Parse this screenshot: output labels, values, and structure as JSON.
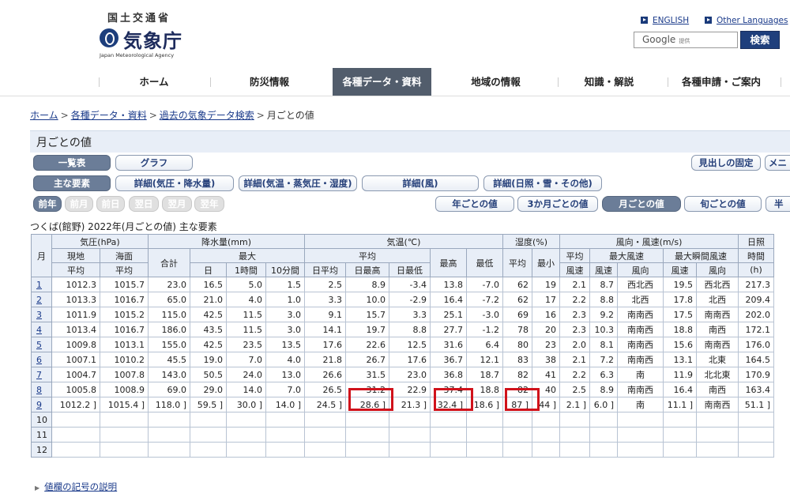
{
  "header": {
    "gov_label": "国土交通省",
    "agency_name": "気象庁",
    "agency_name_en": "Japan Meteorological Agency",
    "lang_english": "ENGLISH",
    "lang_other": "Other Languages",
    "search_placeholder_brand": "Google",
    "search_placeholder_sub": "提供",
    "search_button": "検索"
  },
  "nav": {
    "items": [
      "ホーム",
      "防災情報",
      "各種データ・資料",
      "地域の情報",
      "知識・解説",
      "各種申請・ご案内"
    ],
    "active_index": 2
  },
  "breadcrumb": [
    "ホーム",
    "各種データ・資料",
    "過去の気象データ検索",
    "月ごとの値"
  ],
  "page_title": "月ごとの値",
  "view_buttons": {
    "list": "一覧表",
    "graph": "グラフ"
  },
  "fixed_header_button": "見出しの固定",
  "menu_button_partial": "メニ",
  "element_tabs": [
    "主な要素",
    "詳細(気圧・降水量)",
    "詳細(気温・蒸気圧・湿度)",
    "詳細(風)",
    "詳細(日照・雪・その他)"
  ],
  "nav_buttons": [
    "前年",
    "前月",
    "前日",
    "翌日",
    "翌月",
    "翌年"
  ],
  "period_buttons": [
    "年ごとの値",
    "3か月ごとの値",
    "月ごとの値",
    "旬ごとの値",
    "半"
  ],
  "period_selected_index": 2,
  "subtitle": "つくば(館野)  2022年(月ごとの値)  主な要素",
  "table": {
    "h": {
      "month": "月",
      "pressure": "気圧(hPa)",
      "station": "現地",
      "sea": "海面",
      "avg": "平均",
      "precip": "降水量(mm)",
      "total": "合計",
      "max": "最大",
      "day": "日",
      "hour1": "1時間",
      "min10": "10分間",
      "temp": "気温(℃)",
      "tavg": "平均",
      "daily_avg": "日平均",
      "daily_max": "日最高",
      "daily_min": "日最低",
      "highest": "最高",
      "lowest": "最低",
      "humidity": "湿度(%)",
      "h_avg": "平均",
      "h_min": "最小",
      "wind": "風向・風速(m/s)",
      "wind_avg1": "平均",
      "wind_avg2": "風速",
      "max_wind": "最大風速",
      "max_gust": "最大瞬間風速",
      "speed": "風速",
      "dir": "風向",
      "speed2": "風速",
      "dir2": "風向",
      "sun1": "日照",
      "sun2": "時間",
      "sun3": "(h)"
    },
    "rows": [
      [
        "1",
        "1012.3",
        "1015.7",
        "23.0",
        "16.5",
        "5.0",
        "1.5",
        "2.5",
        "8.9",
        "-3.4",
        "13.8",
        "-7.0",
        "62",
        "19",
        "2.1",
        "8.7",
        "西北西",
        "19.5",
        "西北西",
        "217.3"
      ],
      [
        "2",
        "1013.3",
        "1016.7",
        "65.0",
        "21.0",
        "4.0",
        "1.0",
        "3.3",
        "10.0",
        "-2.9",
        "16.4",
        "-7.2",
        "62",
        "17",
        "2.2",
        "8.8",
        "北西",
        "17.8",
        "北西",
        "209.4"
      ],
      [
        "3",
        "1011.9",
        "1015.2",
        "115.0",
        "42.5",
        "11.5",
        "3.0",
        "9.1",
        "15.7",
        "3.3",
        "25.1",
        "-3.0",
        "69",
        "16",
        "2.3",
        "9.2",
        "南南西",
        "17.5",
        "南南西",
        "202.0"
      ],
      [
        "4",
        "1013.4",
        "1016.7",
        "186.0",
        "43.5",
        "11.5",
        "3.0",
        "14.1",
        "19.7",
        "8.8",
        "27.7",
        "-1.2",
        "78",
        "20",
        "2.3",
        "10.3",
        "南南西",
        "18.8",
        "南西",
        "172.1"
      ],
      [
        "5",
        "1009.8",
        "1013.1",
        "155.0",
        "42.5",
        "23.5",
        "13.5",
        "17.6",
        "22.6",
        "12.5",
        "31.6",
        "6.4",
        "80",
        "23",
        "2.0",
        "8.1",
        "南南西",
        "15.6",
        "南南西",
        "176.0"
      ],
      [
        "6",
        "1007.1",
        "1010.2",
        "45.5",
        "19.0",
        "7.0",
        "4.0",
        "21.8",
        "26.7",
        "17.6",
        "36.7",
        "12.1",
        "83",
        "38",
        "2.1",
        "7.2",
        "南南西",
        "13.1",
        "北東",
        "164.5"
      ],
      [
        "7",
        "1004.7",
        "1007.8",
        "143.0",
        "50.5",
        "24.0",
        "13.0",
        "26.6",
        "31.5",
        "23.0",
        "36.8",
        "18.7",
        "82",
        "41",
        "2.2",
        "6.3",
        "南",
        "11.9",
        "北北東",
        "170.9"
      ],
      [
        "8",
        "1005.8",
        "1008.9",
        "69.0",
        "29.0",
        "14.0",
        "7.0",
        "26.5",
        "31.2",
        "22.9",
        "37.4",
        "18.8",
        "82",
        "40",
        "2.5",
        "8.9",
        "南南西",
        "16.4",
        "南西",
        "163.4"
      ],
      [
        "9",
        "1012.2 ]",
        "1015.4 ]",
        "118.0 ]",
        "59.5 ]",
        "30.0 ]",
        "14.0 ]",
        "24.5 ]",
        "28.6 ]",
        "21.3 ]",
        "32.4 ]",
        "18.6 ]",
        "87 ]",
        "44 ]",
        "2.1 ]",
        "6.0 ]",
        "南",
        "11.1 ]",
        "南南西",
        "51.1 ]"
      ],
      [
        "10",
        "",
        "",
        "",
        "",
        "",
        "",
        "",
        "",
        "",
        "",
        "",
        "",
        "",
        "",
        "",
        "",
        "",
        "",
        ""
      ],
      [
        "11",
        "",
        "",
        "",
        "",
        "",
        "",
        "",
        "",
        "",
        "",
        "",
        "",
        "",
        "",
        "",
        "",
        "",
        "",
        ""
      ],
      [
        "12",
        "",
        "",
        "",
        "",
        "",
        "",
        "",
        "",
        "",
        "",
        "",
        "",
        "",
        "",
        "",
        "",
        "",
        "",
        ""
      ]
    ],
    "linked_months": 9
  },
  "footer_link": "値欄の記号の説明",
  "colors": {
    "highlight": "#d0121b",
    "nav_active": "#525d6c",
    "header_bg": "#e8eef7"
  }
}
